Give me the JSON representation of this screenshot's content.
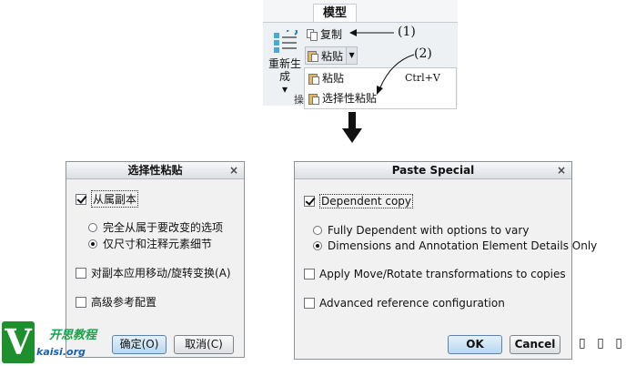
{
  "ribbon": {
    "tab": "模型",
    "regen_label": "重新生成",
    "regen_sub": "▾",
    "copy": "复制",
    "paste": "粘贴",
    "dropdown": {
      "paste": "粘贴",
      "paste_shortcut": "Ctrl+V",
      "paste_special": "选择性粘贴"
    },
    "group_label": "操"
  },
  "callouts": {
    "one": "(1)",
    "two": "(2)"
  },
  "dialog_cn": {
    "title": "选择性粘贴",
    "close": "×",
    "dependent_copy": "从属副本",
    "option_fully": "完全从属于要改变的选项",
    "option_dims": "仅尺寸和注释元素细节",
    "apply_move": "对副本应用移动/旋转变换(A)",
    "advanced_ref": "高级参考配置",
    "ok": "确定(O)",
    "cancel": "取消(C)"
  },
  "dialog_en": {
    "title": "Paste Special",
    "close": "×",
    "dependent_copy": "Dependent copy",
    "option_fully": "Fully Dependent with options to vary",
    "option_dims": "Dimensions and Annotation Element Details Only",
    "apply_move": "Apply Move/Rotate transformations to copies",
    "advanced_ref": "Advanced reference configuration",
    "ok": "OK",
    "cancel": "Cancel"
  },
  "state": {
    "dependent_copy_checked": true,
    "selected_option": "dims",
    "apply_move_checked": false,
    "advanced_ref_checked": false
  },
  "watermark": {
    "letter": "V",
    "text": "开思教程",
    "sub": "kaisi.org"
  },
  "glyphs": "▯ ▯ ▯"
}
